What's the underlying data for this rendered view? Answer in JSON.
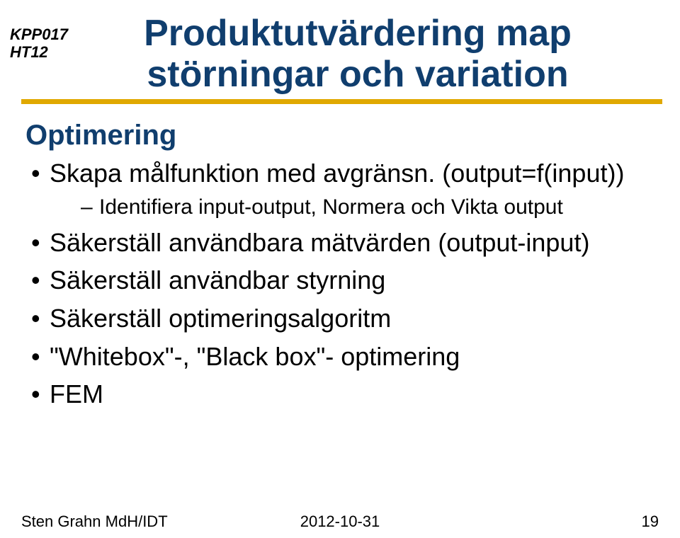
{
  "course": {
    "line1": "KPP017",
    "line2": "HT12"
  },
  "title": {
    "line1": "Produktutvärdering map",
    "line2": "störningar och variation"
  },
  "section_head": "Optimering",
  "bullets": {
    "item1_text": "Skapa målfunktion med avgränsn. (output=f(input))",
    "item1_sub1": "Identifiera input-output, Normera och Vikta output",
    "item2": "Säkerställ användbara mätvärden (output-input)",
    "item3": "Säkerställ användbar styrning",
    "item4": "Säkerställ optimeringsalgoritm",
    "item5": "\"Whitebox\"-, \"Black box\"- optimering",
    "item6": "FEM"
  },
  "footer": {
    "author": "Sten Grahn MdH/IDT",
    "date": "2012-10-31",
    "page": "19"
  }
}
